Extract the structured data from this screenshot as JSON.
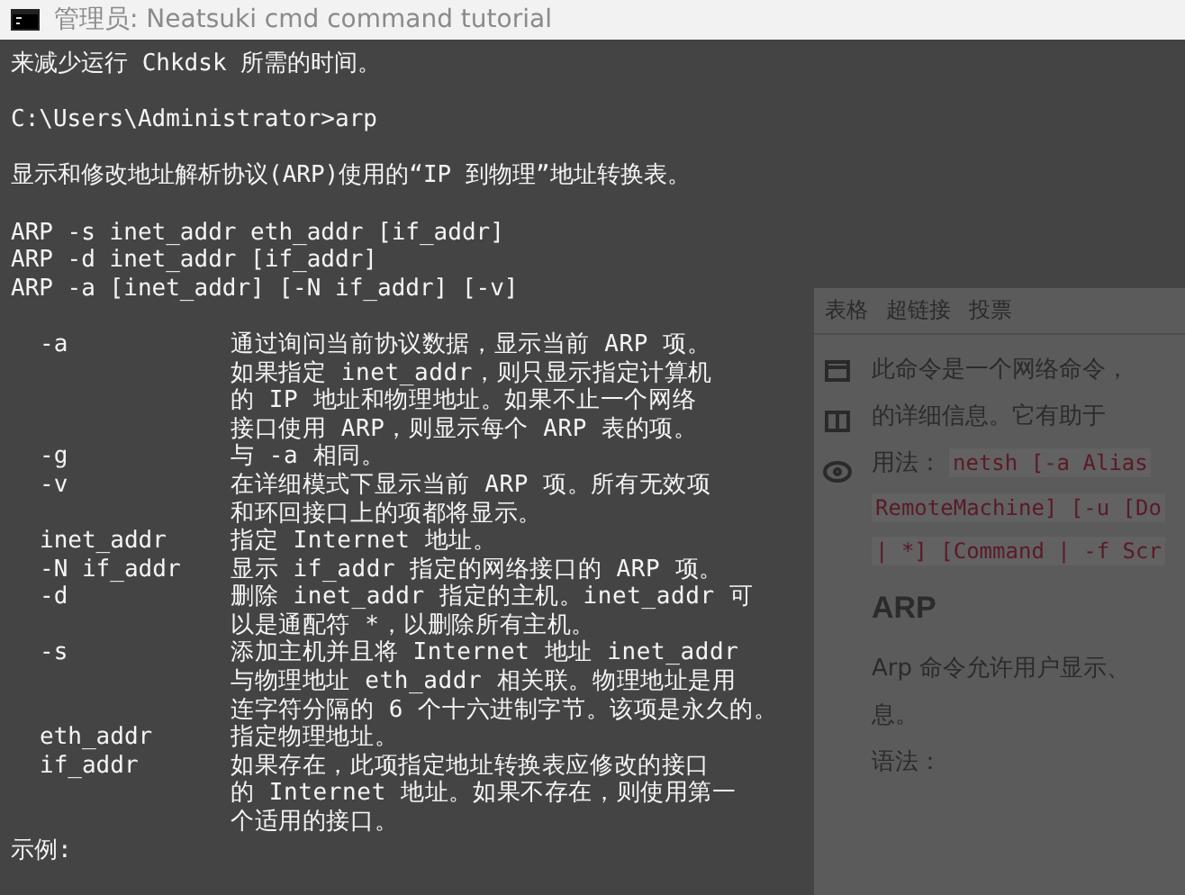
{
  "window": {
    "title": "管理员:  Neatsuki cmd command tutorial"
  },
  "console": {
    "intro": [
      [
        "来减少运行 Chkdsk 所需的时间。"
      ],
      [
        "C:\\Users\\Administrator>arp"
      ],
      [
        "显示和修改地址解析协议(ARP)使用的“IP 到物理”地址转换表。"
      ],
      [
        "ARP -s inet_addr eth_addr [if_addr]",
        "ARP -d inet_addr [if_addr]",
        "ARP -a [inet_addr] [-N if_addr] [-v]"
      ]
    ],
    "options": [
      {
        "option": "-a",
        "lines": [
          "通过询问当前协议数据，显示当前 ARP 项。",
          "如果指定 inet_addr，则只显示指定计算机",
          "的 IP 地址和物理地址。如果不止一个网络",
          "接口使用 ARP，则显示每个 ARP 表的项。"
        ]
      },
      {
        "option": "-g",
        "lines": [
          "与 -a 相同。"
        ]
      },
      {
        "option": "-v",
        "lines": [
          "在详细模式下显示当前 ARP 项。所有无效项",
          "和环回接口上的项都将显示。"
        ]
      },
      {
        "option": "inet_addr",
        "lines": [
          "指定 Internet 地址。"
        ]
      },
      {
        "option": "-N if_addr",
        "lines": [
          "显示 if_addr 指定的网络接口的 ARP 项。"
        ]
      },
      {
        "option": "-d",
        "lines": [
          "删除 inet_addr 指定的主机。inet_addr 可",
          "以是通配符 *，以删除所有主机。"
        ]
      },
      {
        "option": "-s",
        "lines": [
          "添加主机并且将 Internet 地址 inet_addr",
          "与物理地址 eth_addr 相关联。物理地址是用",
          "连字符分隔的 6 个十六进制字节。该项是永久的。"
        ]
      },
      {
        "option": "eth_addr",
        "lines": [
          "指定物理地址。"
        ]
      },
      {
        "option": "if_addr",
        "lines": [
          "如果存在，此项指定地址转换表应修改的接口",
          "的 Internet 地址。如果不存在，则使用第一",
          "个适用的接口。"
        ]
      }
    ],
    "outro": [
      "示例:"
    ]
  },
  "preview": {
    "toolbar": [
      "表格",
      "超链接",
      "投票"
    ],
    "blocks": [
      {
        "kind": "text",
        "text": "此命令是一个网络命令，"
      },
      {
        "kind": "text",
        "text": "的详细信息。它有助于"
      },
      {
        "kind": "code",
        "label": "用法：",
        "text": "netsh [-a Alias"
      },
      {
        "kind": "code",
        "text": "RemoteMachine] [-u [Do"
      },
      {
        "kind": "code",
        "text": "| *] [Command | -f Scr"
      },
      {
        "kind": "heading",
        "text": "ARP"
      },
      {
        "kind": "text",
        "text": "Arp 命令允许用户显示、"
      },
      {
        "kind": "text",
        "text": "息。"
      },
      {
        "kind": "code",
        "label": "语法："
      }
    ]
  }
}
